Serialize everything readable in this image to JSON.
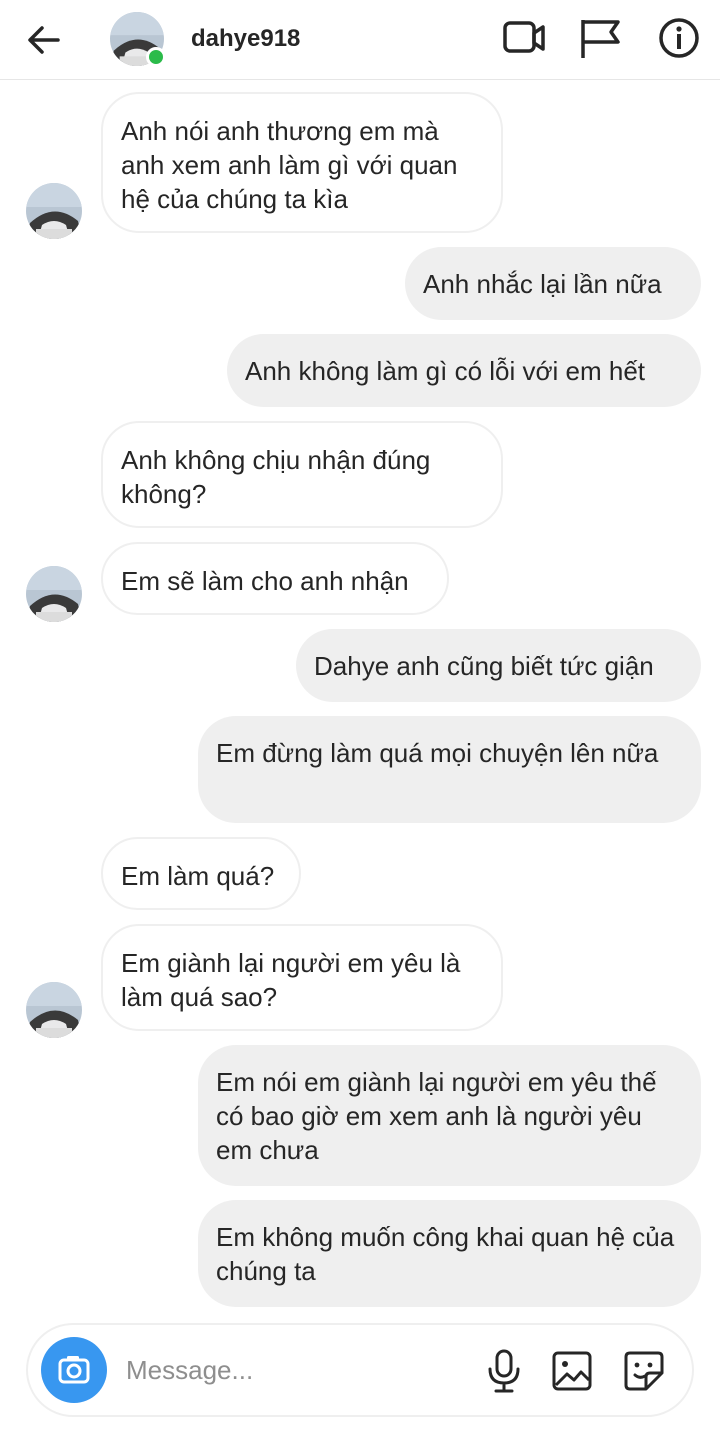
{
  "header": {
    "username": "dahye918",
    "back_icon": "arrow-left-icon",
    "video_icon": "video-call-icon",
    "flag_icon": "flag-icon",
    "info_icon": "info-icon",
    "online_color": "#2bbb4a"
  },
  "messages": [
    {
      "side": "in",
      "text": "Anh nói anh thương em mà anh xem anh làm gì với quan hệ của chúng ta kìa"
    },
    {
      "side": "out",
      "text": "Anh nhắc lại lần nữa"
    },
    {
      "side": "out",
      "text": "Anh không làm gì có lỗi với em hết"
    },
    {
      "side": "in",
      "text": "Anh không chịu nhận đúng không?"
    },
    {
      "side": "in",
      "text": "Em sẽ làm cho anh nhận"
    },
    {
      "side": "out",
      "text": "Dahye anh cũng biết tức giận"
    },
    {
      "side": "out",
      "text": "Em đừng làm quá mọi chuyện lên nữa"
    },
    {
      "side": "in",
      "text": "Em làm quá?"
    },
    {
      "side": "in",
      "text": "Em giành lại người em yêu là làm quá sao?"
    },
    {
      "side": "out",
      "text": "Em nói em giành lại người em yêu thế có bao giờ em xem anh là người yêu em chưa"
    },
    {
      "side": "out",
      "text": "Em không muốn công khai quan hệ của chúng ta"
    }
  ],
  "composer": {
    "placeholder": "Message...",
    "camera_color": "#3897f0"
  },
  "colors": {
    "incoming_bubble": "#ffffff",
    "outgoing_bubble": "#efefef",
    "text": "#262626"
  }
}
